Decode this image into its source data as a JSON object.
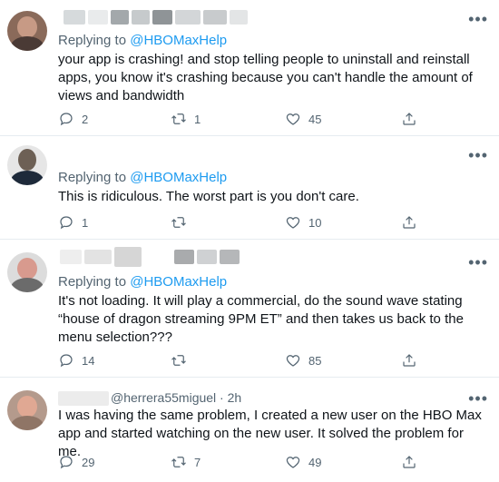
{
  "tweets": [
    {
      "reply_prefix": "Replying to",
      "reply_handle": "@HBOMaxHelp",
      "text": "your app is crashing! and stop telling people to uninstall and reinstall apps, you know it's crashing because you can't handle the amount of views and bandwidth",
      "counts": {
        "replies": "2",
        "retweets": "1",
        "likes": "45"
      }
    },
    {
      "reply_prefix": "Replying to",
      "reply_handle": "@HBOMaxHelp",
      "text": "This is ridiculous. The worst part is you don't care.",
      "counts": {
        "replies": "1",
        "retweets": "",
        "likes": "10"
      }
    },
    {
      "reply_prefix": "Replying to",
      "reply_handle": "@HBOMaxHelp",
      "text": "It's not loading. It will play a commercial, do the sound wave stating “house of dragon streaming 9PM ET” and then takes us back to the menu selection???",
      "counts": {
        "replies": "14",
        "retweets": "",
        "likes": "85"
      }
    },
    {
      "header_partial": "@herrera55miguel · 2h",
      "text": "I was having the same problem, I created a new user on the HBO Max app and started watching on the new user. It solved the problem for me.",
      "counts": {
        "replies": "29",
        "retweets": "7",
        "likes": "49"
      }
    }
  ],
  "more_label": "•••",
  "icons": [
    "reply-icon",
    "retweet-icon",
    "like-icon",
    "share-icon",
    "more-icon"
  ]
}
